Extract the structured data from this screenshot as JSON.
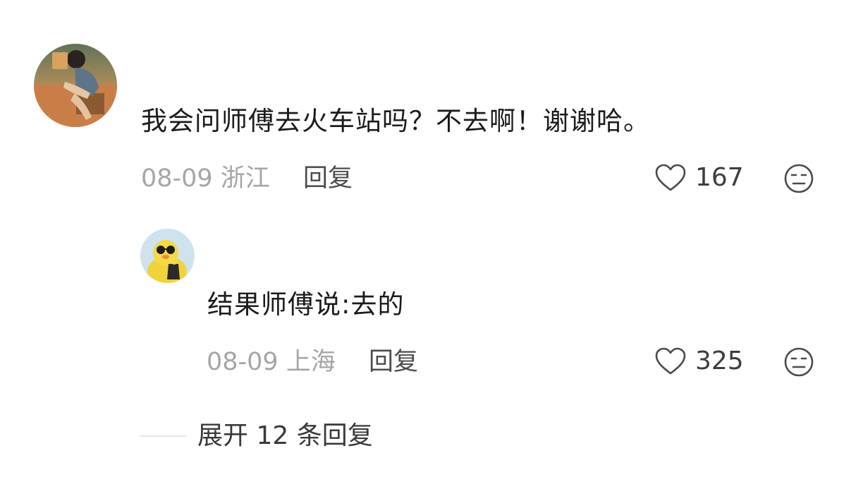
{
  "comment": {
    "text": "我会问师傅去火车站吗？不去啊！谢谢哈。",
    "date_location": "08-09 浙江",
    "reply_label": "回复",
    "likes": "167",
    "avatar_icon": "avatar-photo-girl-with-book"
  },
  "reply": {
    "text": "结果师傅说:去的",
    "date_location": "08-09 上海",
    "reply_label": "回复",
    "likes": "325",
    "avatar_icon": "avatar-yellow-duck-sunglasses"
  },
  "expand": {
    "label": "展开 12 条回复"
  },
  "icons": {
    "like": "heart-outline-icon",
    "emoji": "neutral-face-icon"
  },
  "colors": {
    "text_primary": "#1b1b1b",
    "text_meta": "#a6a6a6",
    "text_action": "#4c4c4c"
  }
}
